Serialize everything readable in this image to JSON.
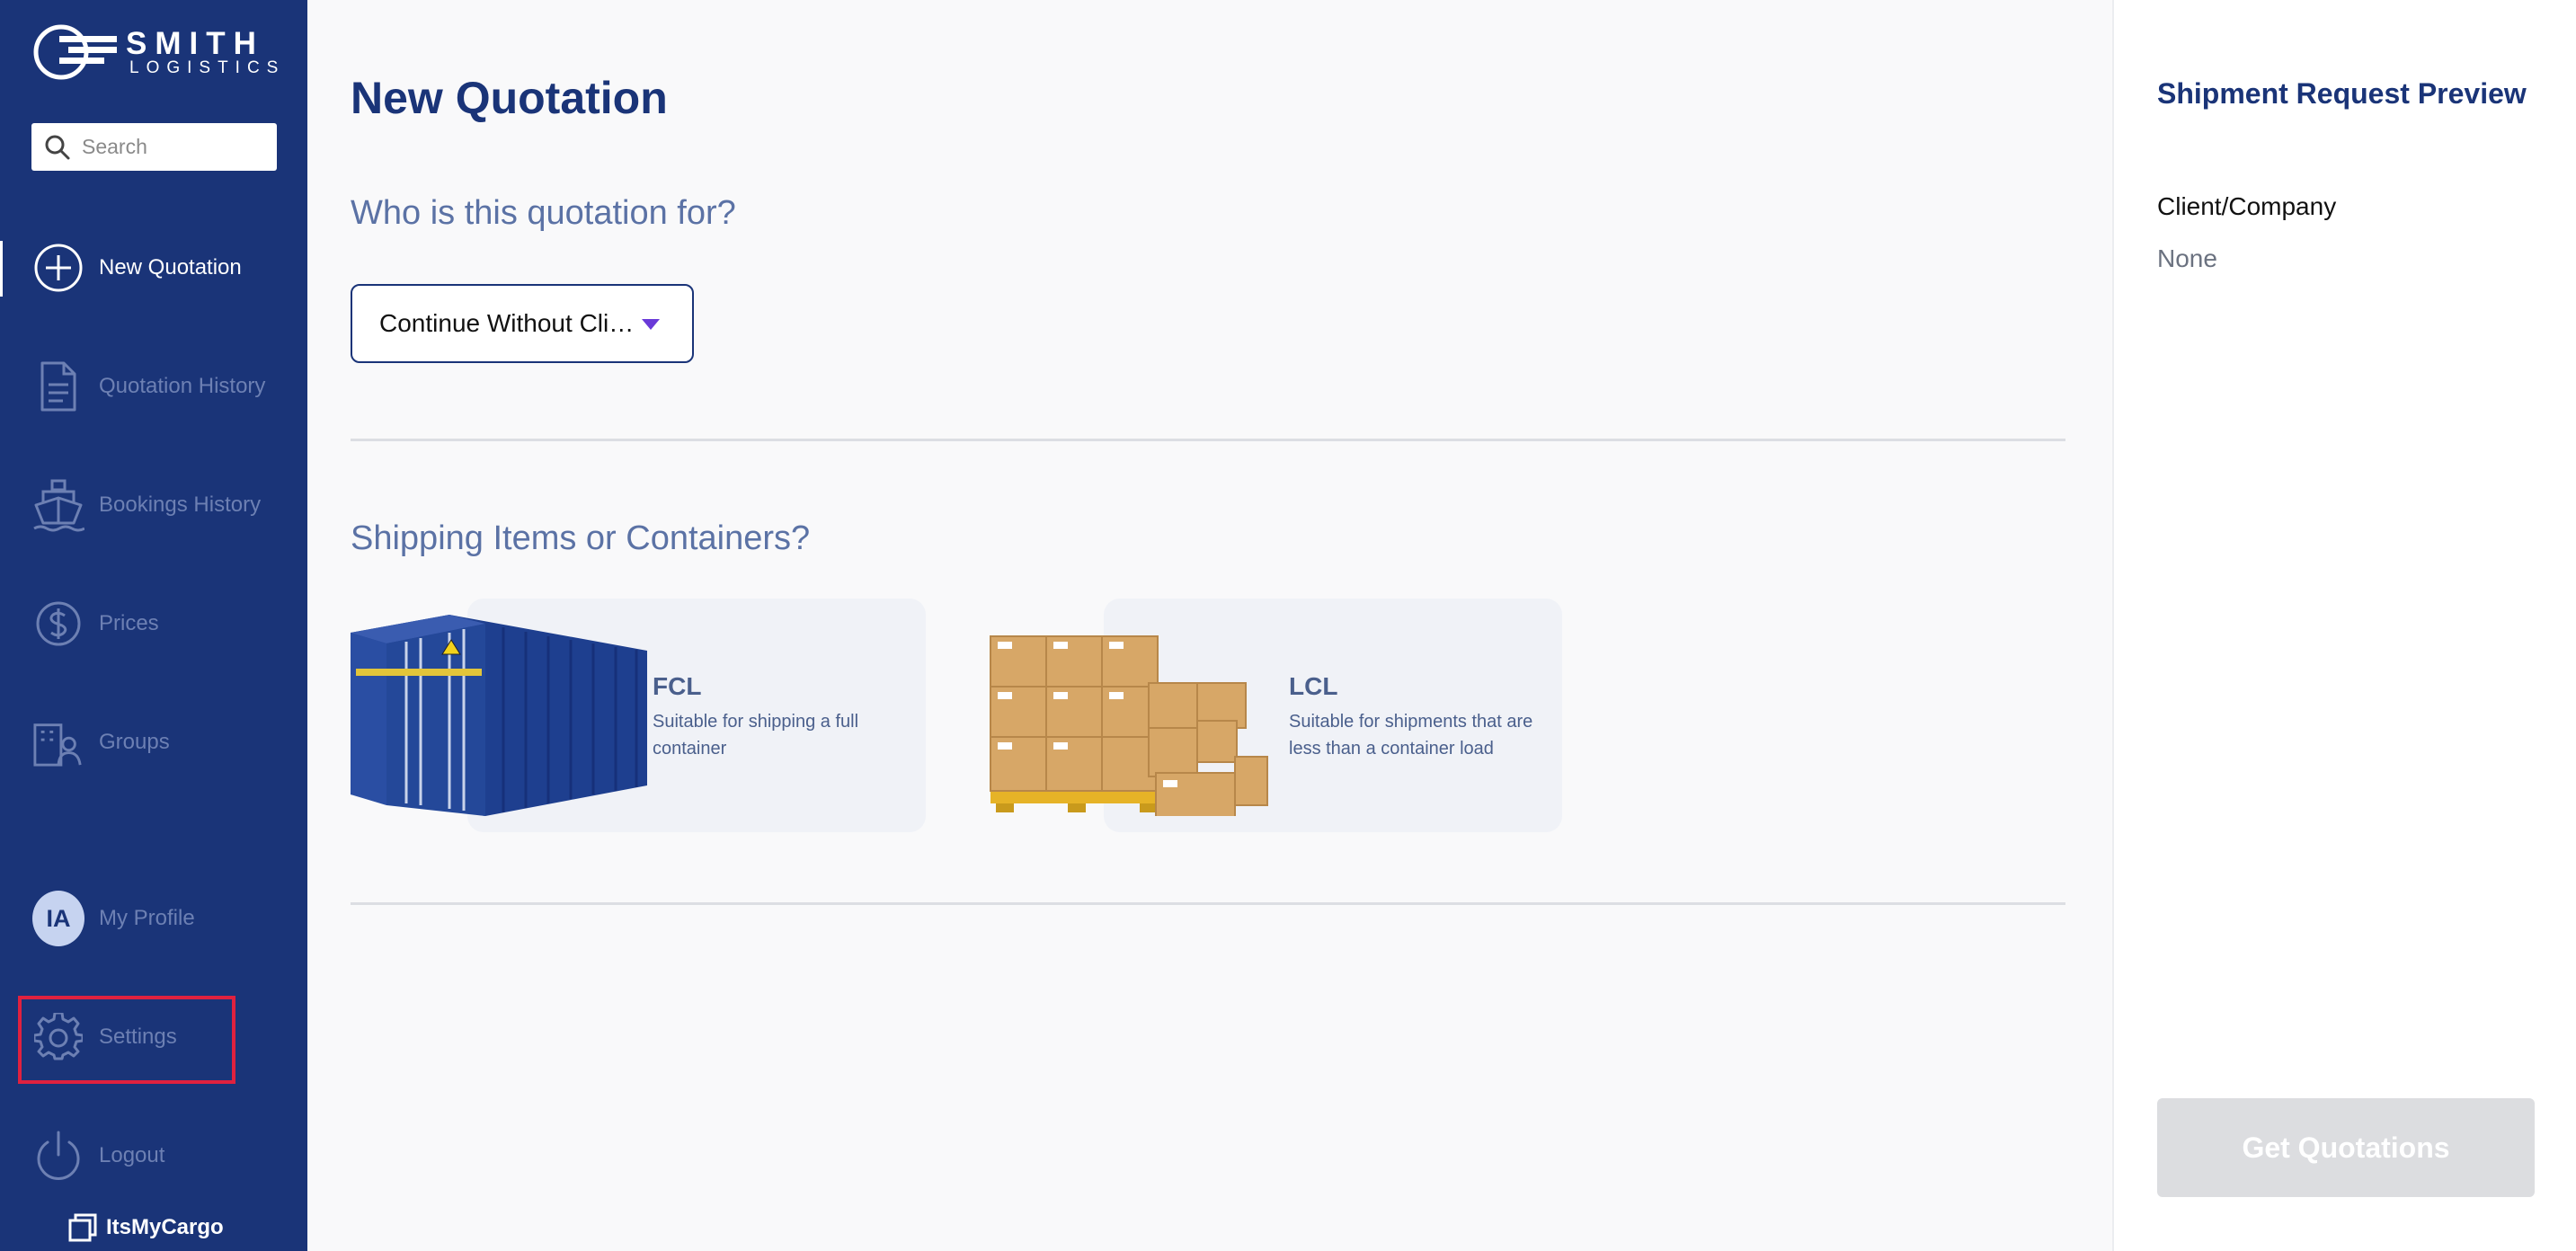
{
  "brand": {
    "name": "SMITH",
    "sub": "LOGISTICS"
  },
  "search": {
    "placeholder": "Search"
  },
  "sidebar": {
    "items": [
      {
        "label": "New Quotation",
        "icon": "plus-circle-icon",
        "active": true
      },
      {
        "label": "Quotation History",
        "icon": "document-icon"
      },
      {
        "label": "Bookings History",
        "icon": "ship-icon"
      },
      {
        "label": "Prices",
        "icon": "dollar-circle-icon"
      },
      {
        "label": "Groups",
        "icon": "groups-icon"
      }
    ],
    "profile": {
      "initials": "IA",
      "label": "My Profile"
    },
    "settings": {
      "label": "Settings",
      "icon": "gear-icon"
    },
    "logout": {
      "label": "Logout",
      "icon": "power-icon"
    },
    "footer_brand": "ItsMyCargo"
  },
  "main": {
    "title": "New Quotation",
    "question": "Who is this quotation for?",
    "client_dropdown": {
      "value": "Continue Without Cli…"
    },
    "shipping_question": "Shipping Items or Containers?",
    "options": [
      {
        "title": "FCL",
        "description": "Suitable for shipping a full container",
        "image": "shipping-container"
      },
      {
        "title": "LCL",
        "description": "Suitable for shipments that are less than a container load",
        "image": "cardboard-boxes-pallet"
      }
    ]
  },
  "preview": {
    "title": "Shipment Request Preview",
    "client_label": "Client/Company",
    "client_value": "None",
    "button_label": "Get Quotations"
  },
  "colors": {
    "sidebar_bg": "#1a3478",
    "accent": "#1a3478",
    "highlight": "#e0213f",
    "caret": "#6a3ad8",
    "disabled_button": "#dcdde0"
  }
}
